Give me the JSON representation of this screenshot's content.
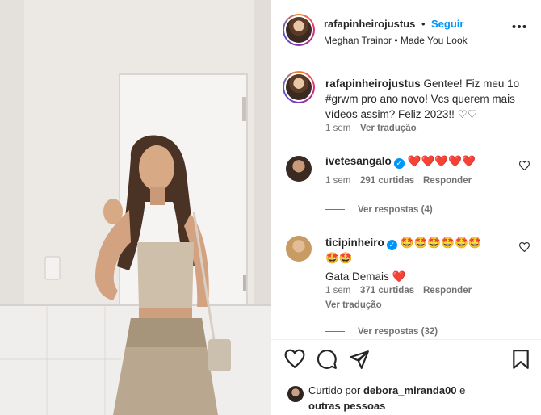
{
  "post": {
    "author": "rafapinheirojustus",
    "separator": "•",
    "follow_label": "Seguir",
    "music": "Meghan Trainor • Made You Look",
    "more_label": "•••"
  },
  "caption": {
    "author": "rafapinheirojustus",
    "text": "Gentee! Fiz meu 1o #grwm pro ano novo! Vcs querem mais vídeos assim? Feliz 2023!! ♡♡",
    "time": "1 sem",
    "translate_label": "Ver tradução"
  },
  "comments": [
    {
      "author": "ivetesangalo",
      "verified_icon": "✓",
      "text": "❤️❤️❤️❤️❤️",
      "time": "1 sem",
      "likes": "291 curtidas",
      "reply_label": "Responder",
      "view_replies": "Ver respostas (4)"
    },
    {
      "author": "ticipinheiro",
      "verified_icon": "✓",
      "text_line1": "🤩🤩🤩🤩🤩🤩",
      "text_line2": "🤩🤩",
      "text_line3": "Gata Demais ❤️",
      "time": "1 sem",
      "likes": "371 curtidas",
      "reply_label": "Responder",
      "translate_label": "Ver tradução",
      "view_replies": "Ver respostas (32)"
    }
  ],
  "footer": {
    "liked_by_prefix": "Curtido por",
    "liked_by_user": "debora_miranda00",
    "liked_by_conj": "e",
    "liked_by_others": "outras pessoas"
  },
  "icons": {
    "heart": "heart-icon",
    "comment": "comment-icon",
    "share": "share-icon",
    "save": "bookmark-icon",
    "more": "more-icon"
  },
  "colors": {
    "accent": "#0095f6",
    "heart_red": "#ed4956",
    "muted": "#737373"
  }
}
